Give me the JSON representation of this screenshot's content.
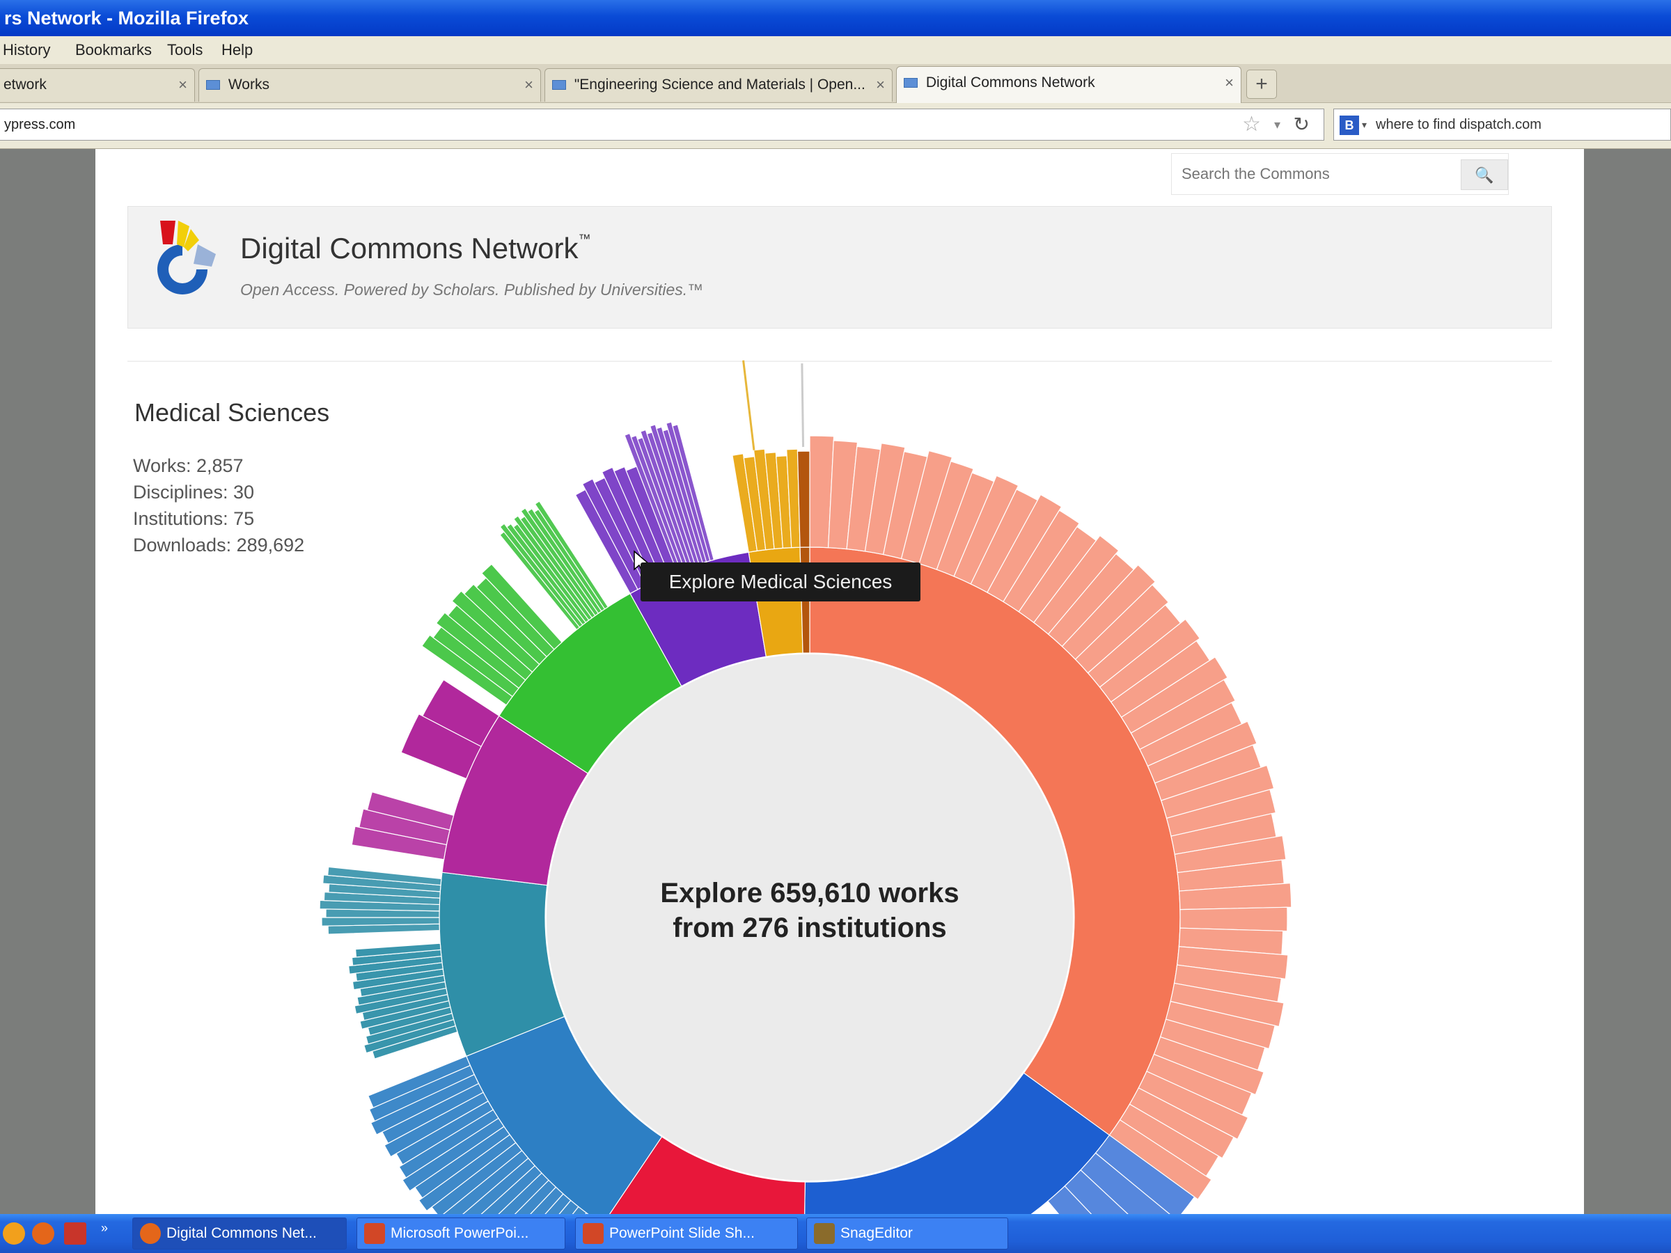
{
  "window": {
    "title": "rs Network - Mozilla Firefox"
  },
  "menu": {
    "items": [
      "History",
      "Bookmarks",
      "Tools",
      "Help"
    ]
  },
  "tabs": [
    {
      "label": "etwork"
    },
    {
      "label": "Works"
    },
    {
      "label": "\"Engineering Science and Materials | Open..."
    },
    {
      "label": "Digital Commons Network"
    }
  ],
  "addressbar": {
    "url": "ypress.com",
    "search_text": "where to find dispatch.com"
  },
  "site": {
    "search_placeholder": "Search the Commons",
    "title": "Digital Commons Network",
    "title_mark": "™",
    "tagline": "Open Access. Powered by Scholars. Published by Universities.™"
  },
  "discipline": {
    "name": "Medical Sciences",
    "stats": [
      "Works: 2,857",
      "Disciplines: 30",
      "Institutions: 75",
      "Downloads: 289,692"
    ]
  },
  "chart_center": {
    "line1": "Explore 659,610 works",
    "line2": "from 276 institutions"
  },
  "tooltip": "Explore Medical Sciences",
  "chart_data": {
    "type": "sunburst",
    "colors": [
      "#f47656",
      "#1d5fd1",
      "#e8173a",
      "#2d7fc4",
      "#2f8fa8",
      "#b1289c",
      "#34c033",
      "#6d2cc0",
      "#e9a712",
      "#b3560d"
    ]
  },
  "taskbar": {
    "tasks": [
      {
        "label": "Digital Commons Net...",
        "active": true
      },
      {
        "label": "Microsoft PowerPoi..."
      },
      {
        "label": "PowerPoint Slide Sh..."
      },
      {
        "label": "SnagEditor"
      }
    ]
  }
}
